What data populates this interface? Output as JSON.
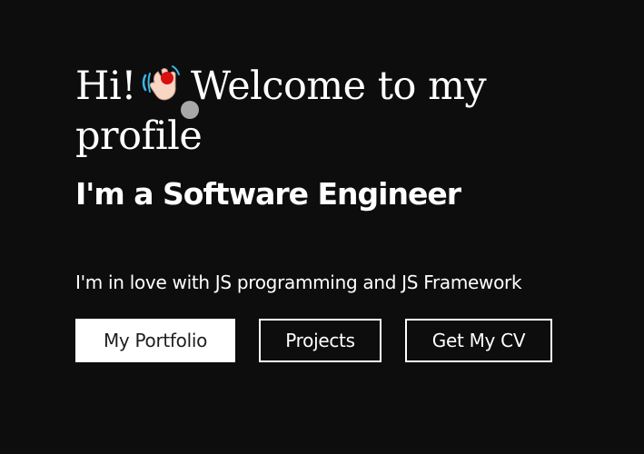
{
  "hero": {
    "greeting": "Hi!",
    "welcome_text": "Welcome to my profile",
    "wave_icon": "waving-hand-icon",
    "role": "I'm a Software Engineer",
    "tagline": "I'm in love with JS programming and JS Framework"
  },
  "actions": {
    "portfolio_label": "My Portfolio",
    "projects_label": "Projects",
    "cv_label": "Get My CV"
  },
  "colors": {
    "background": "#0e0d0d",
    "text": "#ffffff",
    "primary_button_bg": "#ffffff",
    "primary_button_text": "#1e1e1e"
  }
}
